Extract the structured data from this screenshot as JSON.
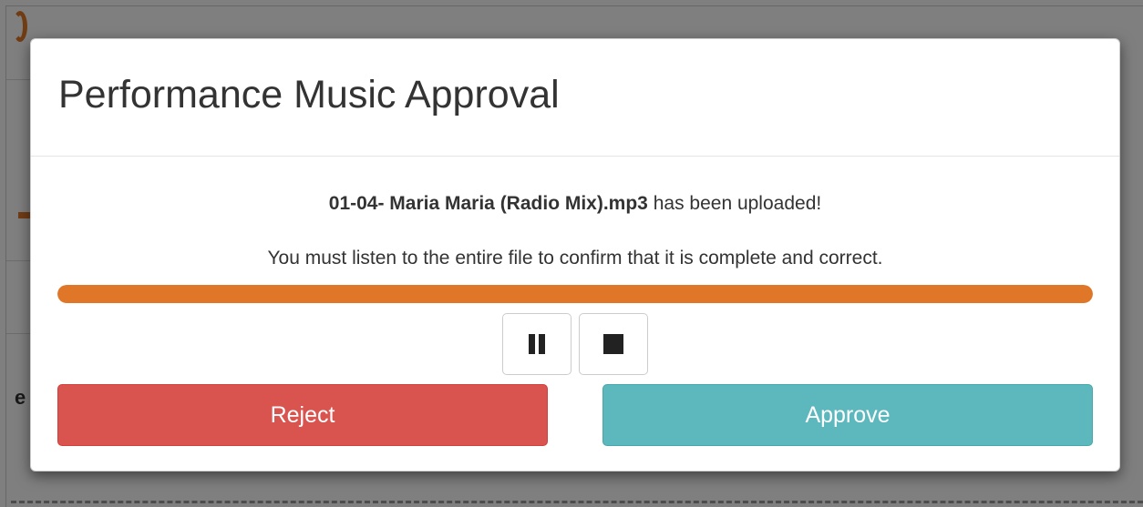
{
  "modal": {
    "title": "Performance Music Approval",
    "upload": {
      "filename": "01-04- Maria Maria (Radio Mix).mp3",
      "suffix": " has been uploaded!"
    },
    "instruction": "You must listen to the entire file to confirm that it is complete and correct.",
    "progress_fraction": 1.0,
    "controls": {
      "pause_icon": "pause-icon",
      "stop_icon": "stop-icon"
    },
    "buttons": {
      "reject_label": "Reject",
      "approve_label": "Approve"
    }
  },
  "background": {
    "partial_letter": "e"
  },
  "colors": {
    "progress": "#e07728",
    "reject": "#d9534f",
    "approve": "#5cb8bc",
    "brand_orange": "#e07828"
  }
}
